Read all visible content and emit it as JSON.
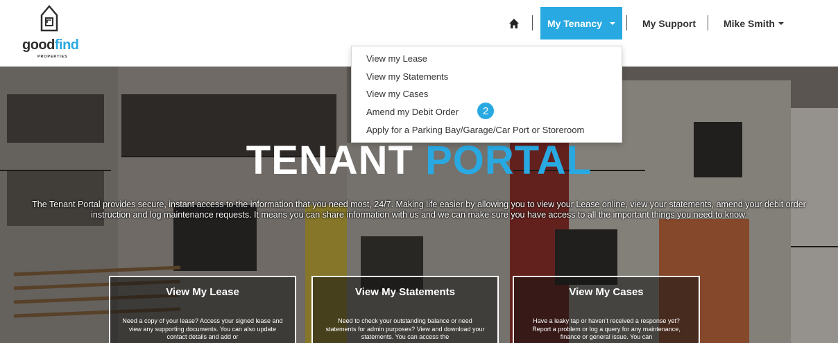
{
  "brand": {
    "word_a": "good",
    "word_b": "find",
    "sub": "PROPERTIES"
  },
  "nav": {
    "home_icon": "home-icon",
    "tenancy": "My Tenancy",
    "support": "My Support",
    "user": "Mike Smith"
  },
  "dropdown": {
    "items": [
      "View my Lease",
      "View my Statements",
      "View my Cases",
      "Amend my Debit Order",
      "Apply for a Parking Bay/Garage/Car Port or Storeroom"
    ],
    "badge": "2"
  },
  "hero": {
    "title_a": "TENANT",
    "title_b": "PORTAL",
    "intro": "The Tenant Portal provides secure, instant access to the information that you need most, 24/7. Making life easier by allowing you to view your Lease online, view your statements, amend your debit order instruction and log maintenance requests. It means you can share information with us and we can make sure you have access to all the important things you need to know."
  },
  "cards": [
    {
      "title": "View My Lease",
      "text": "Need a copy of your lease? Access your signed lease and view any supporting documents. You can also update contact details and add or"
    },
    {
      "title": "View My Statements",
      "text": "Need to check your outstanding balance or need statements for admin purposes? View and download your statements. You can access the"
    },
    {
      "title": "View My Cases",
      "text": "Have a leaky tap or haven't received a response yet? Report a problem or log a query for any maintenance, finance or general issue. You can"
    }
  ],
  "colors": {
    "accent": "#29a9e1"
  }
}
